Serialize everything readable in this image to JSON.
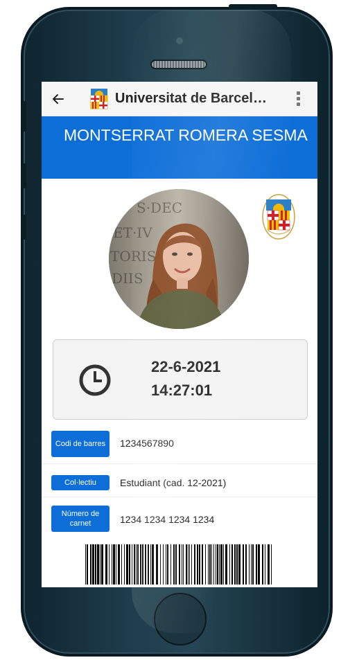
{
  "appbar": {
    "title": "Universitat de Barcelona",
    "back_icon": "arrow-left-icon",
    "menu_icon": "more-vert-icon"
  },
  "card": {
    "holder_name": "MONTSERRAT ROMERA SESMA",
    "date": "22-6-2021",
    "time": "14:27:01",
    "fields": [
      {
        "label": "Codi de barres",
        "value": "1234567890"
      },
      {
        "label": "Col·lectiu",
        "value": "Estudiant (cad. 12-2021)"
      },
      {
        "label": "Número de carnet",
        "value": "1234 1234 1234 1234"
      }
    ],
    "barcode_value": "1234567890"
  },
  "colors": {
    "accent": "#0d6ed8",
    "appbar_bg": "#f6f6f6",
    "card_bg": "#f3f3f3",
    "phone_frame": "#1f3d4c"
  }
}
